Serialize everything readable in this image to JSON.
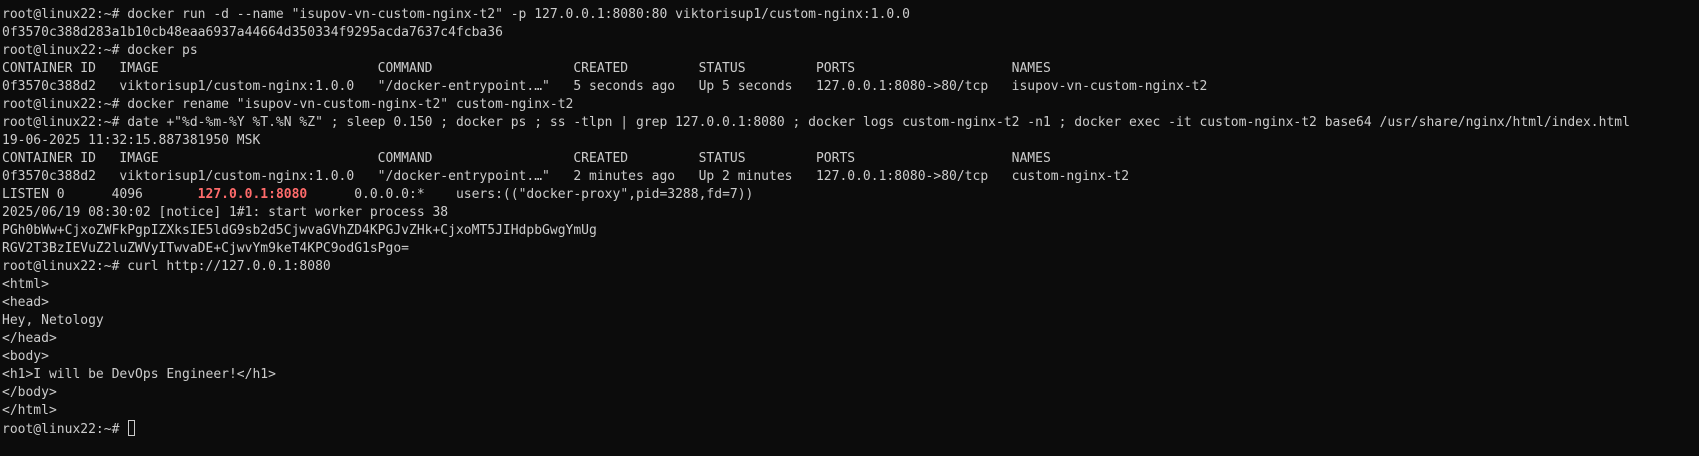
{
  "terminal": {
    "lines": [
      "root@linux22:~# docker run -d --name \"isupov-vn-custom-nginx-t2\" -p 127.0.0.1:8080:80 viktorisup1/custom-nginx:1.0.0",
      "0f3570c388d283a1b10cb48eaa6937a44664d350334f9295acda7637c4fcba36",
      "root@linux22:~# docker ps",
      "CONTAINER ID   IMAGE                            COMMAND                  CREATED         STATUS         PORTS                    NAMES",
      "0f3570c388d2   viktorisup1/custom-nginx:1.0.0   \"/docker-entrypoint.…\"   5 seconds ago   Up 5 seconds   127.0.0.1:8080->80/tcp   isupov-vn-custom-nginx-t2",
      "root@linux22:~# docker rename \"isupov-vn-custom-nginx-t2\" custom-nginx-t2",
      "root@linux22:~# date +\"%d-%m-%Y %T.%N %Z\" ; sleep 0.150 ; docker ps ; ss -tlpn | grep 127.0.0.1:8080 ; docker logs custom-nginx-t2 -n1 ; docker exec -it custom-nginx-t2 base64 /usr/share/nginx/html/index.html",
      "19-06-2025 11:32:15.887381950 MSK",
      "CONTAINER ID   IMAGE                            COMMAND                  CREATED         STATUS         PORTS                    NAMES",
      "0f3570c388d2   viktorisup1/custom-nginx:1.0.0   \"/docker-entrypoint.…\"   2 minutes ago   Up 2 minutes   127.0.0.1:8080->80/tcp   custom-nginx-t2"
    ],
    "listen_line": {
      "before": "LISTEN 0      4096       ",
      "highlight": "127.0.0.1:8080",
      "after": "      0.0.0.0:*    users:((\"docker-proxy\",pid=3288,fd=7))"
    },
    "lines_after": [
      "2025/06/19 08:30:02 [notice] 1#1: start worker process 38",
      "PGh0bWw+CjxoZWFkPgpIZXksIE5ldG9sb2d5CjwvaGVhZD4KPGJvZHk+CjxoMT5JIHdpbGwgYmUg",
      "RGV2T3BzIEVuZ2luZWVyITwvaDE+CjwvYm9keT4KPC9odG1sPgo=",
      "root@linux22:~# curl http://127.0.0.1:8080",
      "<html>",
      "<head>",
      "Hey, Netology",
      "</head>",
      "<body>",
      "<h1>I will be DevOps Engineer!</h1>",
      "</body>",
      "</html>"
    ],
    "prompt": "root@linux22:~# ",
    "colors": {
      "background": "#0c0c0c",
      "foreground": "#cccccc",
      "highlight": "#ff6b6b"
    }
  }
}
